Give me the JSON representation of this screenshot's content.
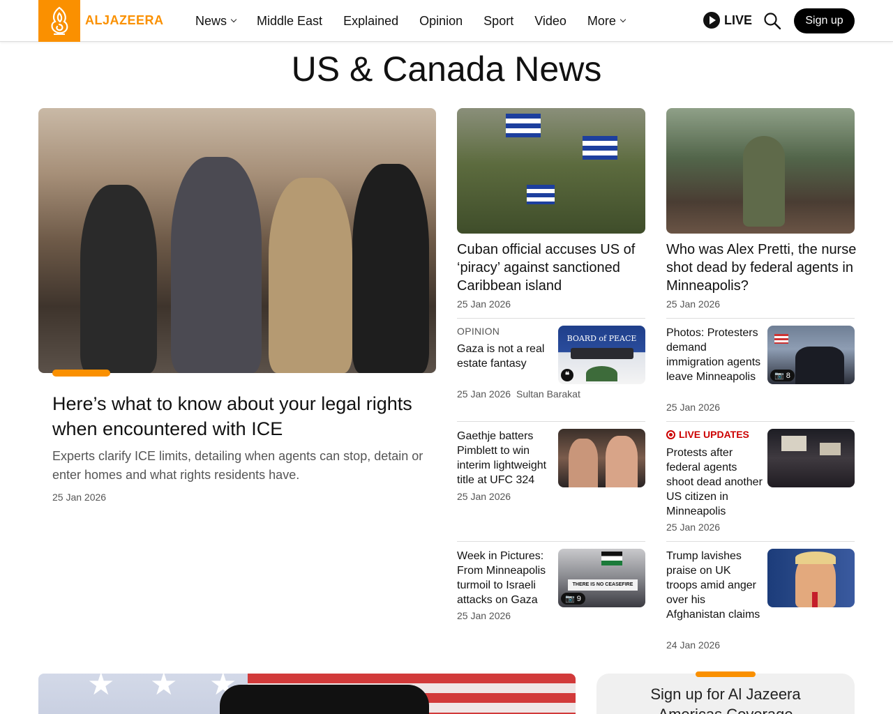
{
  "header": {
    "logo_text": "ALJAZEERA",
    "nav": [
      {
        "label": "News",
        "dropdown": true
      },
      {
        "label": "Middle East",
        "dropdown": false
      },
      {
        "label": "Explained",
        "dropdown": false
      },
      {
        "label": "Opinion",
        "dropdown": false
      },
      {
        "label": "Sport",
        "dropdown": false
      },
      {
        "label": "Video",
        "dropdown": false
      },
      {
        "label": "More",
        "dropdown": true
      }
    ],
    "live_label": "LIVE",
    "signup_label": "Sign up"
  },
  "page_title": "US & Canada News",
  "hero": {
    "title": "Here’s what to know about your legal rights when encountered with ICE",
    "description": "Experts clarify ICE limits, detailing when agents can stop, detain or enter homes and what rights residents have.",
    "date": "25 Jan 2026"
  },
  "top_cards": [
    {
      "title": "Cuban official accuses US of ‘piracy’ against sanctioned Caribbean island",
      "date": "25 Jan 2026"
    },
    {
      "title": "Who was Alex Pretti, the nurse shot dead by federal agents in Minneapolis?",
      "date": "25 Jan 2026"
    }
  ],
  "small_cards": {
    "gaza": {
      "kicker": "OPINION",
      "title": "Gaza is not a real estate fantasy",
      "date": "25 Jan 2026",
      "author": "Sultan Barakat",
      "thumb_text": "BOARD of PEACE"
    },
    "protest_photos": {
      "title": "Photos: Protesters demand immigration agents leave Minneapolis",
      "date": "25 Jan 2026",
      "photo_count": "8"
    },
    "ufc": {
      "title": "Gaethje batters Pimblett to win interim lightweight title at UFC 324",
      "date": "25 Jan 2026"
    },
    "live_protests": {
      "kicker": "LIVE UPDATES",
      "title": "Protests after federal agents shoot dead another US citizen in Minneapolis",
      "date": "25 Jan 2026"
    },
    "week_pictures": {
      "title": "Week in Pictures: From Minneapolis turmoil to Israeli attacks on Gaza",
      "date": "25 Jan 2026",
      "photo_count": "9",
      "thumb_text": "THERE IS NO CEASEFIRE"
    },
    "trump": {
      "title": "Trump lavishes praise on UK troops amid anger over his Afghanistan claims",
      "date": "24 Jan 2026"
    }
  },
  "newsletter": {
    "title": "Sign up for Al Jazeera",
    "subtitle": "Americas Coverage"
  },
  "colors": {
    "brand_orange": "#fa9000",
    "live_red": "#cc0000",
    "text_dark": "#111111",
    "text_muted": "#555555"
  }
}
